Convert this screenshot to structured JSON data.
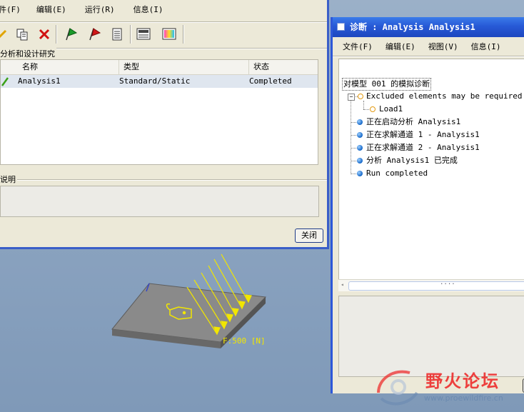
{
  "left_window": {
    "menu": [
      "件(F)",
      "编辑(E)",
      "运行(R)",
      "信息(I)"
    ],
    "toolbar_icons": [
      "edit-pencil-icon",
      "copy-icon",
      "delete-x-icon",
      "start-flag-icon",
      "stop-flag-icon",
      "status-list-icon",
      "report-icon",
      "results-icon"
    ],
    "study_group_label": "分析和设计研究",
    "table": {
      "headers": [
        "名称",
        "类型",
        "状态"
      ],
      "rows": [
        {
          "name": "Analysis1",
          "type": "Standard/Static",
          "status": "Completed"
        }
      ]
    },
    "description_label": "说明",
    "close_button": "关闭"
  },
  "model_view": {
    "load_label": "F:500 [N]"
  },
  "right_window": {
    "title": "诊断 : Analysis Analysis1",
    "menu": [
      "文件(F)",
      "编辑(E)",
      "视图(V)",
      "信息(I)"
    ],
    "tree_header": "对模型 001 的模拟诊断",
    "tree": [
      {
        "label": "Excluded elements may be required near",
        "icon": "warning-orange",
        "level": 0
      },
      {
        "label": "Load1",
        "icon": "warning-orange",
        "level": 1
      },
      {
        "label": "正在启动分析 Analysis1",
        "icon": "info-blue",
        "level": 0
      },
      {
        "label": "正在求解通道 1 - Analysis1",
        "icon": "info-blue",
        "level": 0
      },
      {
        "label": "正在求解通道 2 - Analysis1",
        "icon": "info-blue",
        "level": 0
      },
      {
        "label": "分析 Analysis1 已完成",
        "icon": "info-blue",
        "level": 0
      },
      {
        "label": "Run completed",
        "icon": "info-blue",
        "level": 0
      }
    ],
    "scroll_grip": "...."
  },
  "watermark": {
    "cn": "野火论坛",
    "url": "www.proewildfire.cn"
  },
  "colors": {
    "title_blue": "#2759d6",
    "selected_row": "#dfe6ef",
    "load_arrow_yellow": "#f2e600"
  }
}
